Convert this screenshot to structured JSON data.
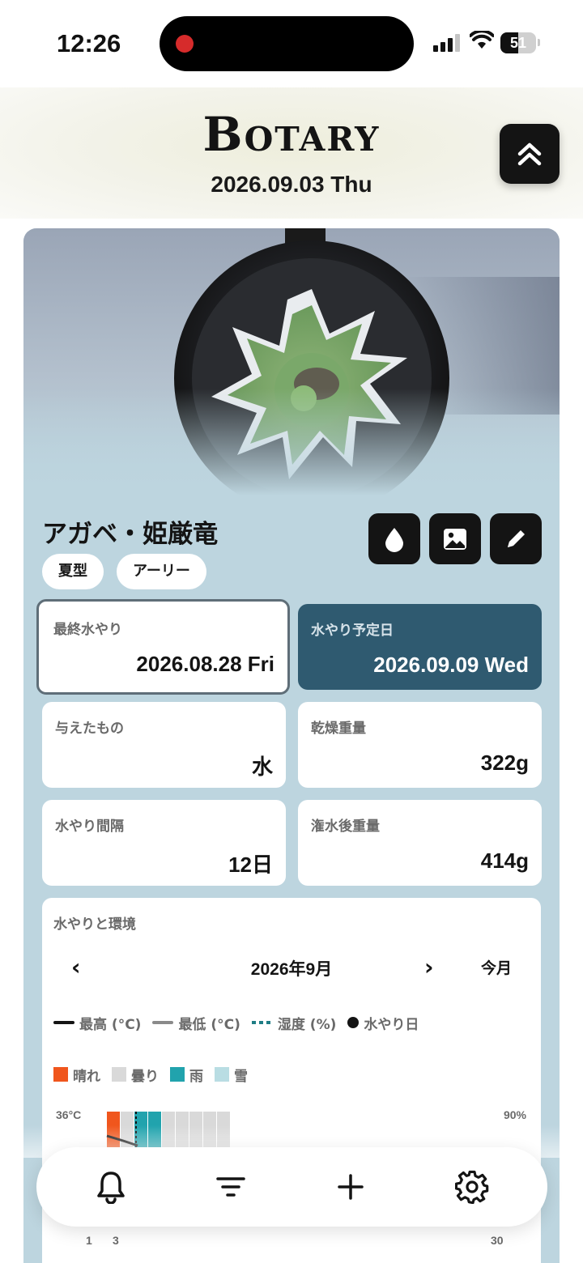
{
  "status_bar": {
    "time": "12:26",
    "battery": "51"
  },
  "header": {
    "logo": "Botary",
    "date": "2026.09.03 Thu"
  },
  "plant": {
    "name": "アガベ・姫厳竜",
    "tags": [
      "夏型",
      "アーリー"
    ]
  },
  "actions": {
    "water_icon": "water-drop-icon",
    "photo_icon": "image-icon",
    "edit_icon": "pencil-icon"
  },
  "info": {
    "last_water": {
      "label": "最終水やり",
      "value": "2026.08.28 Fri"
    },
    "next_water": {
      "label": "水やり予定日",
      "value": "2026.09.09 Wed"
    },
    "given": {
      "label": "与えたもの",
      "value": "水"
    },
    "dry_weight": {
      "label": "乾燥重量",
      "value": "322g"
    },
    "interval": {
      "label": "水やり間隔",
      "value": "12日"
    },
    "wet_weight": {
      "label": "潅水後重量",
      "value": "414g"
    }
  },
  "environment": {
    "title": "水やりと環境",
    "month": "2026年9月",
    "prev": "‹",
    "next": "›",
    "this_month": "今月",
    "legend_lines": {
      "max": "最高 (°C)",
      "min": "最低 (°C)",
      "humidity": "湿度 (%)",
      "water_day": "水やり日"
    },
    "legend_weather": {
      "sunny": "晴れ",
      "cloudy": "曇り",
      "rain": "雨",
      "snow": "雪"
    },
    "colors": {
      "sunny": "#f0561d",
      "cloudy": "#d9d9d9",
      "rain": "#21a3ad",
      "snow": "#b9dde3",
      "humidity": "#1f7d85"
    },
    "axis": {
      "temp_max": "36°C",
      "humidity_max": "90%"
    },
    "x_ticks": [
      "1",
      "3",
      "30"
    ],
    "weather_days": [
      "sunny",
      "cloudy",
      "rain",
      "rain",
      "cloudy",
      "cloudy",
      "cloudy",
      "cloudy",
      "cloudy"
    ]
  },
  "bottom_nav": [
    "bell-icon",
    "filter-icon",
    "plus-icon",
    "gear-icon"
  ]
}
